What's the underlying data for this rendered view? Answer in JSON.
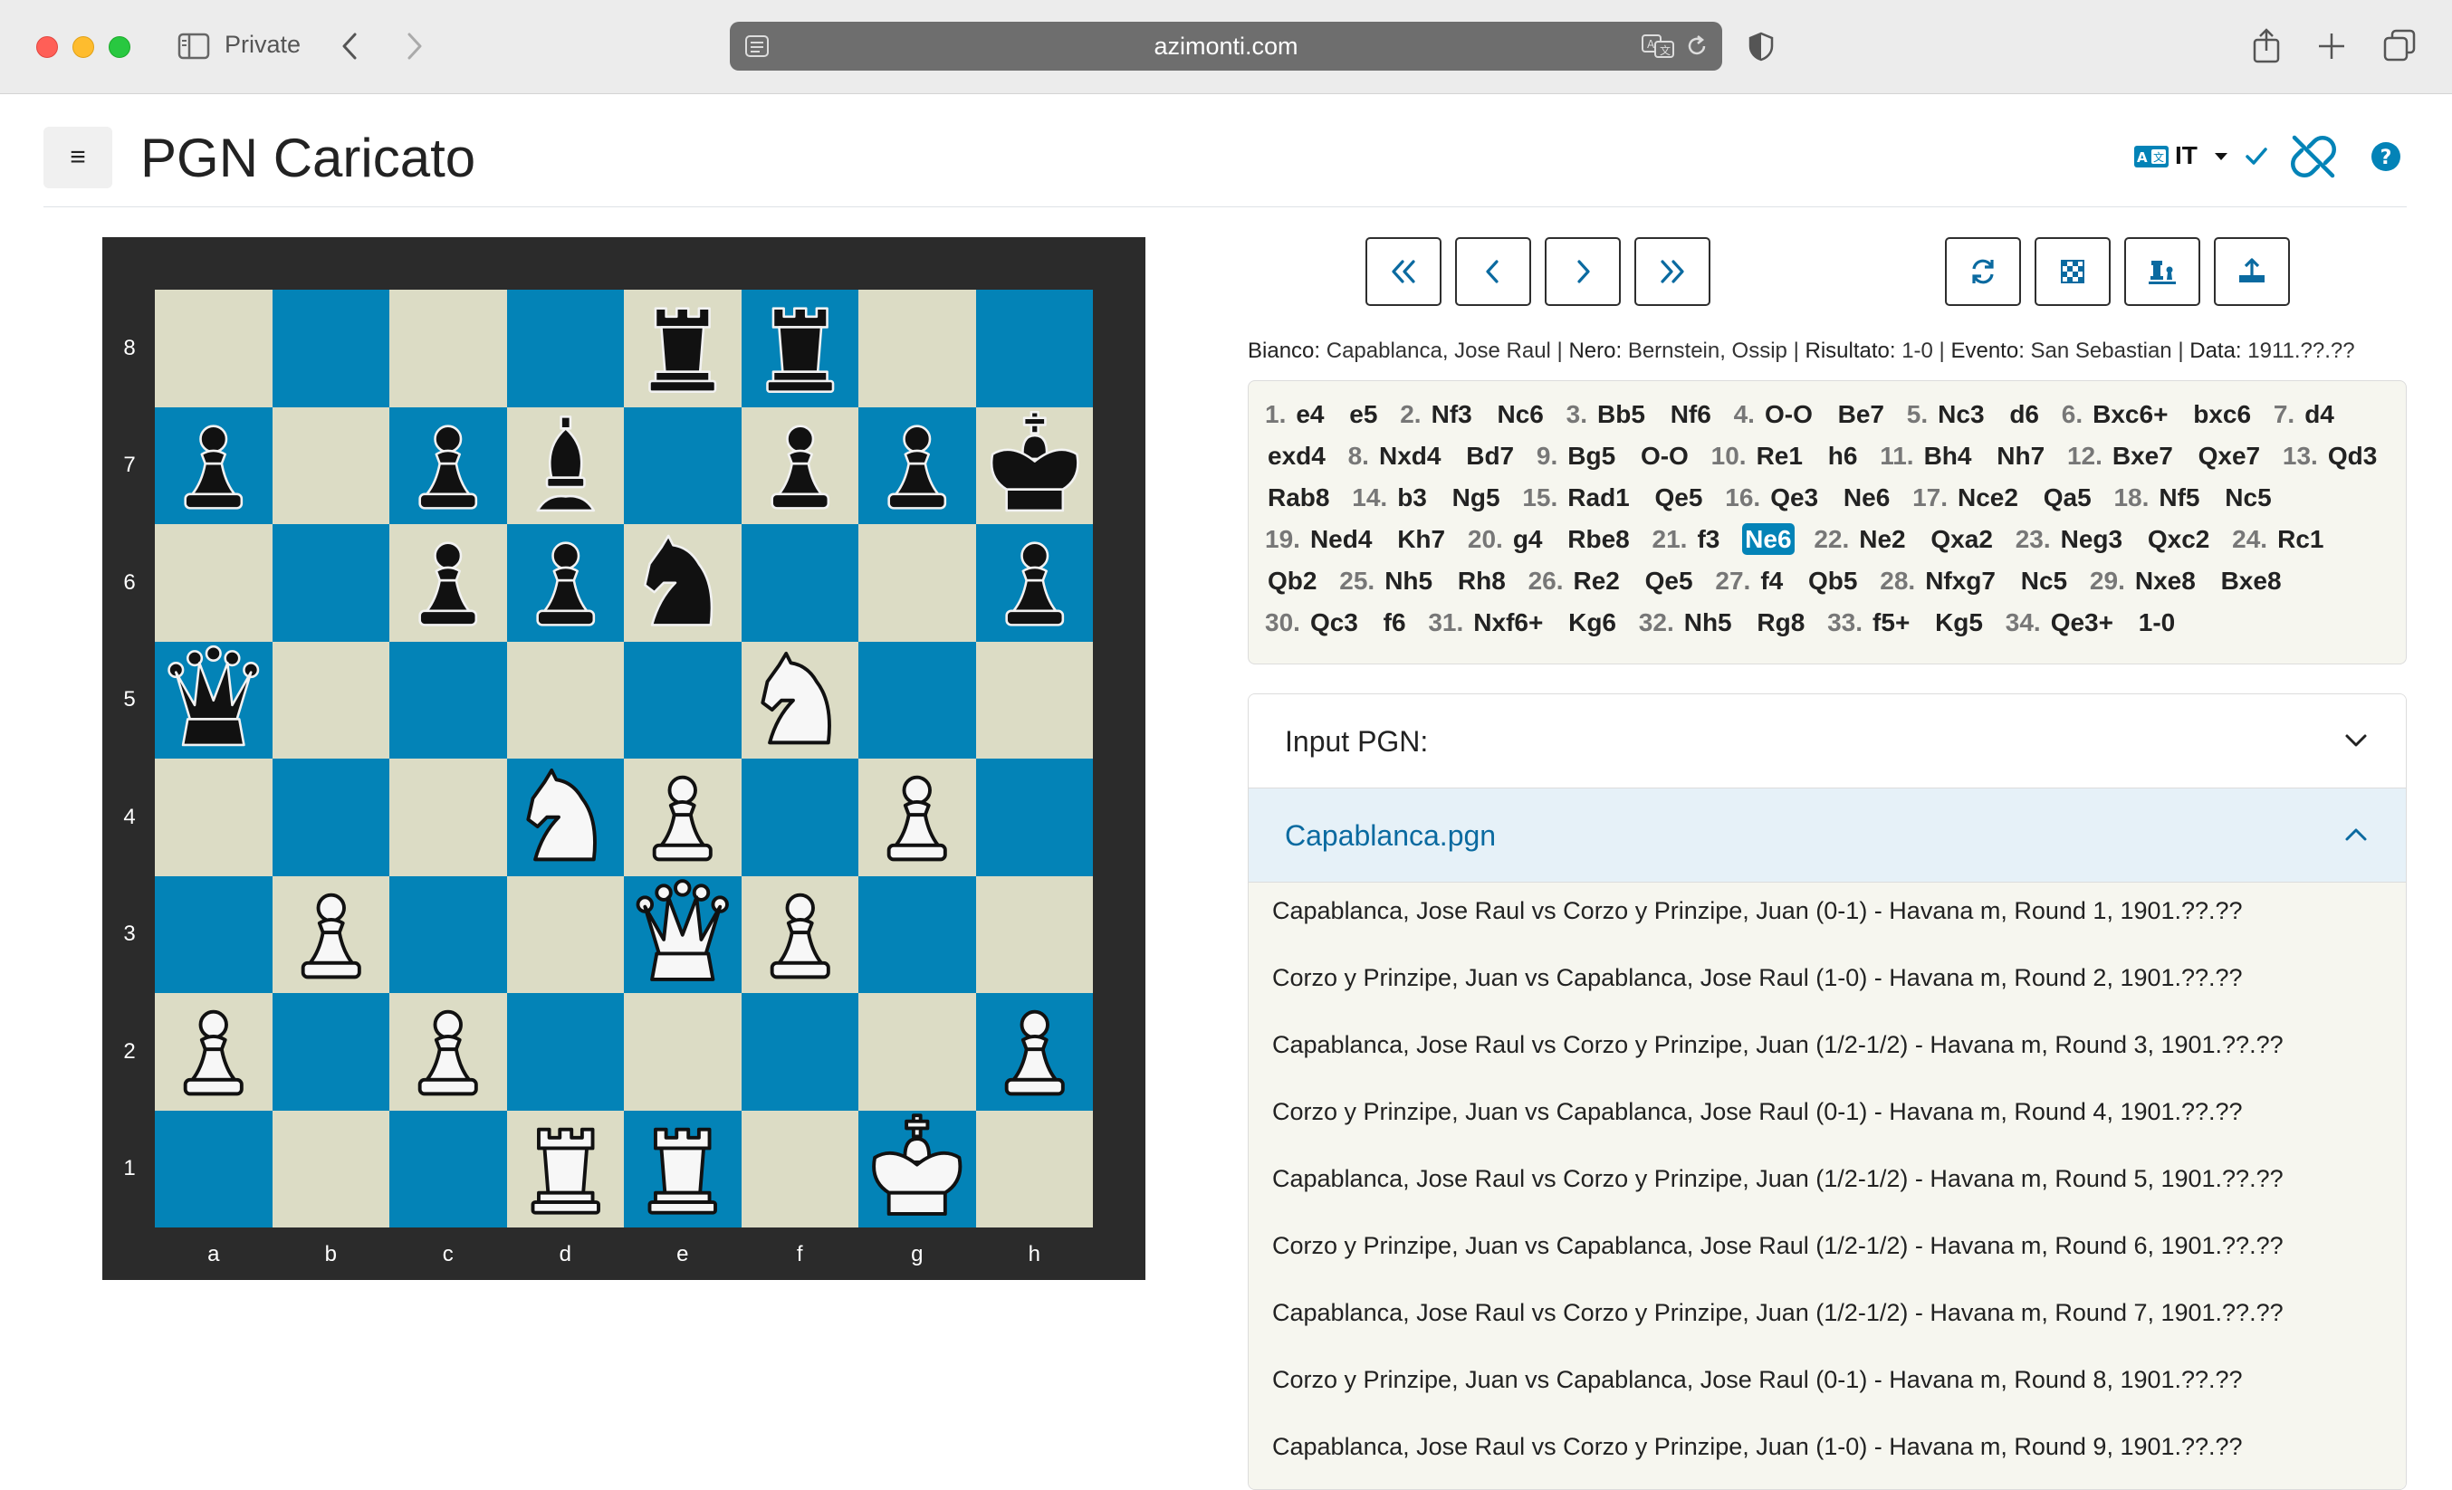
{
  "browser": {
    "private_label": "Private",
    "url": "azimonti.com"
  },
  "header": {
    "menu_glyph": "≡",
    "title": "PGN Caricato",
    "lang_code": "IT"
  },
  "board": {
    "files": [
      "a",
      "b",
      "c",
      "d",
      "e",
      "f",
      "g",
      "h"
    ],
    "ranks": [
      "8",
      "7",
      "6",
      "5",
      "4",
      "3",
      "2",
      "1"
    ],
    "position": [
      [
        "",
        "",
        "",
        "",
        "bR",
        "bR",
        "",
        ""
      ],
      [
        "bP",
        "",
        "bP",
        "bB",
        "",
        "bP",
        "bP",
        "bK"
      ],
      [
        "",
        "",
        "bP",
        "bP",
        "bN",
        "",
        "",
        "bP"
      ],
      [
        "bQ",
        "",
        "",
        "",
        "",
        "wN",
        "",
        ""
      ],
      [
        "",
        "",
        "",
        "wN",
        "wP",
        "",
        "wP",
        ""
      ],
      [
        "",
        "wP",
        "",
        "",
        "wQ",
        "wP",
        "",
        ""
      ],
      [
        "wP",
        "",
        "wP",
        "",
        "",
        "",
        "",
        "wP"
      ],
      [
        "",
        "",
        "",
        "wR",
        "wR",
        "",
        "wK",
        ""
      ]
    ],
    "colors": {
      "light": "#dcdcc5",
      "dark": "#0383b7",
      "frame": "#2b2b2b"
    }
  },
  "controls": {
    "nav": [
      "first-move",
      "previous-move",
      "next-move",
      "last-move"
    ],
    "tools": [
      "flip-board",
      "board-theme",
      "piece-set",
      "export"
    ]
  },
  "game_info": {
    "white_label": "Bianco:",
    "white": "Capablanca, Jose Raul",
    "black_label": "Nero:",
    "black": "Bernstein, Ossip",
    "result_label": "Risultato:",
    "result": "1-0",
    "event_label": "Evento:",
    "event": "San Sebastian",
    "date_label": "Data:",
    "date": "1911.??.??"
  },
  "moves": {
    "list": [
      [
        "1.",
        "e4",
        "e5"
      ],
      [
        "2.",
        "Nf3",
        "Nc6"
      ],
      [
        "3.",
        "Bb5",
        "Nf6"
      ],
      [
        "4.",
        "O-O",
        "Be7"
      ],
      [
        "5.",
        "Nc3",
        "d6"
      ],
      [
        "6.",
        "Bxc6+",
        "bxc6"
      ],
      [
        "7.",
        "d4",
        "exd4"
      ],
      [
        "8.",
        "Nxd4",
        "Bd7"
      ],
      [
        "9.",
        "Bg5",
        "O-O"
      ],
      [
        "10.",
        "Re1",
        "h6"
      ],
      [
        "11.",
        "Bh4",
        "Nh7"
      ],
      [
        "12.",
        "Bxe7",
        "Qxe7"
      ],
      [
        "13.",
        "Qd3",
        "Rab8"
      ],
      [
        "14.",
        "b3",
        "Ng5"
      ],
      [
        "15.",
        "Rad1",
        "Qe5"
      ],
      [
        "16.",
        "Qe3",
        "Ne6"
      ],
      [
        "17.",
        "Nce2",
        "Qa5"
      ],
      [
        "18.",
        "Nf5",
        "Nc5"
      ],
      [
        "19.",
        "Ned4",
        "Kh7"
      ],
      [
        "20.",
        "g4",
        "Rbe8"
      ],
      [
        "21.",
        "f3",
        "Ne6"
      ],
      [
        "22.",
        "Ne2",
        "Qxa2"
      ],
      [
        "23.",
        "Neg3",
        "Qxc2"
      ],
      [
        "24.",
        "Rc1",
        "Qb2"
      ],
      [
        "25.",
        "Nh5",
        "Rh8"
      ],
      [
        "26.",
        "Re2",
        "Qe5"
      ],
      [
        "27.",
        "f4",
        "Qb5"
      ],
      [
        "28.",
        "Nfxg7",
        "Nc5"
      ],
      [
        "29.",
        "Nxe8",
        "Bxe8"
      ],
      [
        "30.",
        "Qc3",
        "f6"
      ],
      [
        "31.",
        "Nxf6+",
        "Kg6"
      ],
      [
        "32.",
        "Nh5",
        "Rg8"
      ],
      [
        "33.",
        "f5+",
        "Kg5"
      ],
      [
        "34.",
        "Qe3+",
        ""
      ]
    ],
    "result": "1-0",
    "current": "21b"
  },
  "accordion": {
    "input_label": "Input PGN:",
    "file_label": "Capablanca.pgn",
    "games": [
      "Capablanca, Jose Raul vs Corzo y Prinzipe, Juan (0-1) - Havana m, Round 1, 1901.??.??",
      "Corzo y Prinzipe, Juan vs Capablanca, Jose Raul (1-0) - Havana m, Round 2, 1901.??.??",
      "Capablanca, Jose Raul vs Corzo y Prinzipe, Juan (1/2-1/2) - Havana m, Round 3, 1901.??.??",
      "Corzo y Prinzipe, Juan vs Capablanca, Jose Raul (0-1) - Havana m, Round 4, 1901.??.??",
      "Capablanca, Jose Raul vs Corzo y Prinzipe, Juan (1/2-1/2) - Havana m, Round 5, 1901.??.??",
      "Corzo y Prinzipe, Juan vs Capablanca, Jose Raul (1/2-1/2) - Havana m, Round 6, 1901.??.??",
      "Capablanca, Jose Raul vs Corzo y Prinzipe, Juan (1/2-1/2) - Havana m, Round 7, 1901.??.??",
      "Corzo y Prinzipe, Juan vs Capablanca, Jose Raul (0-1) - Havana m, Round 8, 1901.??.??",
      "Capablanca, Jose Raul vs Corzo y Prinzipe, Juan (1-0) - Havana m, Round 9, 1901.??.??"
    ]
  },
  "accent_color": "#0383b7"
}
